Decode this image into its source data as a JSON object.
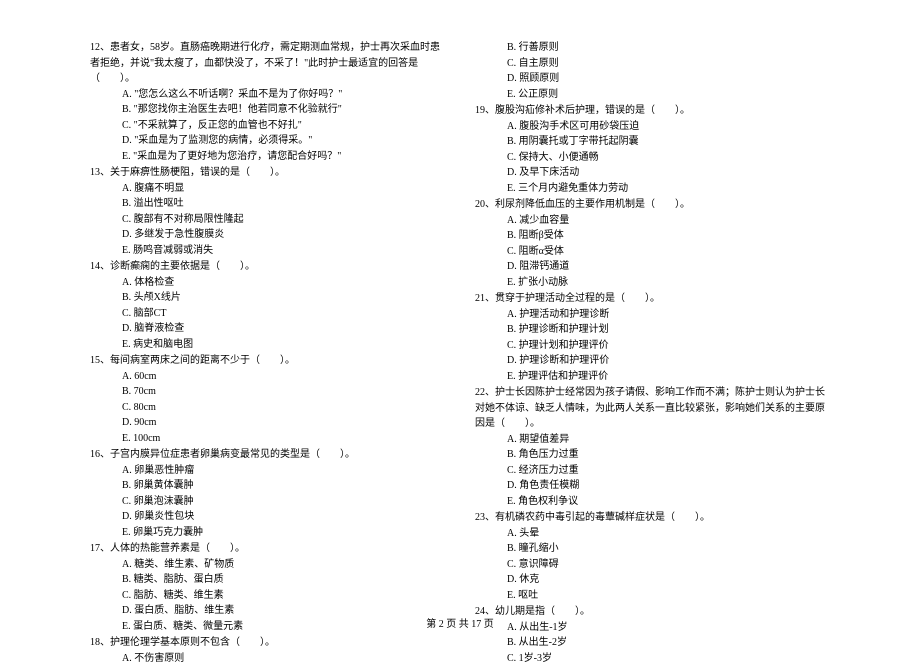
{
  "left": {
    "q12": {
      "text": "12、患者女，58岁。直肠癌晚期进行化疗，需定期测血常规，护士再次采血时患者拒绝，并说\"我太瘦了，血都快没了，不采了！\"此时护士最适宜的回答是（　　）。",
      "A": "A. \"您怎么这么不听话啊？采血不是为了你好吗？\"",
      "B": "B. \"那您找你主治医生去吧！他若同意不化验就行\"",
      "C": "C. \"不采就算了，反正您的血管也不好扎\"",
      "D": "D. \"采血是为了监测您的病情，必须得采。\"",
      "E": "E. \"采血是为了更好地为您治疗，请您配合好吗？\""
    },
    "q13": {
      "text": "13、关于麻痹性肠梗阻，错误的是（　　）。",
      "A": "A. 腹痛不明显",
      "B": "B. 溢出性呕吐",
      "C": "C. 腹部有不对称局限性隆起",
      "D": "D. 多继发于急性腹膜炎",
      "E": "E. 肠鸣音减弱或消失"
    },
    "q14": {
      "text": "14、诊断癫痫的主要依据是（　　）。",
      "A": "A. 体格检查",
      "B": "B. 头颅X线片",
      "C": "C. 脑部CT",
      "D": "D. 脑脊液检查",
      "E": "E. 病史和脑电图"
    },
    "q15": {
      "text": "15、每间病室两床之间的距离不少于（　　）。",
      "A": "A. 60cm",
      "B": "B. 70cm",
      "C": "C. 80cm",
      "D": "D. 90cm",
      "E": "E. 100cm"
    },
    "q16": {
      "text": "16、子宫内膜异位症患者卵巢病变最常见的类型是（　　）。",
      "A": "A. 卵巢恶性肿瘤",
      "B": "B. 卵巢黄体囊肿",
      "C": "C. 卵巢泡沫囊肿",
      "D": "D. 卵巢炎性包块",
      "E": "E. 卵巢巧克力囊肿"
    },
    "q17": {
      "text": "17、人体的热能营养素是（　　）。",
      "A": "A. 糖类、维生素、矿物质",
      "B": "B. 糖类、脂肪、蛋白质",
      "C": "C. 脂肪、糖类、维生素",
      "D": "D. 蛋白质、脂肪、维生素",
      "E": "E. 蛋白质、糖类、微量元素"
    },
    "q18": {
      "text": "18、护理伦理学基本原则不包含（　　）。",
      "A": "A. 不伤害原则"
    }
  },
  "right": {
    "q18r": {
      "B": "B. 行善原则",
      "C": "C. 自主原则",
      "D": "D. 照顾原则",
      "E": "E. 公正原则"
    },
    "q19": {
      "text": "19、腹股沟疝修补术后护理，错误的是（　　）。",
      "A": "A. 腹股沟手术区可用砂袋压迫",
      "B": "B. 用阴囊托或丁字带托起阴囊",
      "C": "C. 保持大、小便通畅",
      "D": "D. 及早下床活动",
      "E": "E. 三个月内避免重体力劳动"
    },
    "q20": {
      "text": "20、利尿剂降低血压的主要作用机制是（　　）。",
      "A": "A. 减少血容量",
      "B": "B. 阻断β受体",
      "C": "C. 阻断α受体",
      "D": "D. 阻滞钙通道",
      "E": "E. 扩张小动脉"
    },
    "q21": {
      "text": "21、贯穿于护理活动全过程的是（　　）。",
      "A": "A. 护理活动和护理诊断",
      "B": "B. 护理诊断和护理计划",
      "C": "C. 护理计划和护理评价",
      "D": "D. 护理诊断和护理评价",
      "E": "E. 护理评估和护理评价"
    },
    "q22": {
      "text": "22、护士长因陈护士经常因为孩子请假、影响工作而不满；陈护士则认为护士长对她不体谅、缺乏人情味，为此两人关系一直比较紧张，影响她们关系的主要原因是（　　）。",
      "A": "A. 期望值差异",
      "B": "B. 角色压力过重",
      "C": "C. 经济压力过重",
      "D": "D. 角色责任模糊",
      "E": "E. 角色权利争议"
    },
    "q23": {
      "text": "23、有机磷农药中毒引起的毒蕈碱样症状是（　　）。",
      "A": "A. 头晕",
      "B": "B. 瞳孔缩小",
      "C": "C. 意识障碍",
      "D": "D. 休克",
      "E": "E. 呕吐"
    },
    "q24": {
      "text": "24、幼儿期是指（　　）。",
      "A": "A. 从出生-1岁",
      "B": "B. 从出生-2岁",
      "C": "C. 1岁-3岁"
    }
  },
  "footer": "第 2 页 共 17 页"
}
